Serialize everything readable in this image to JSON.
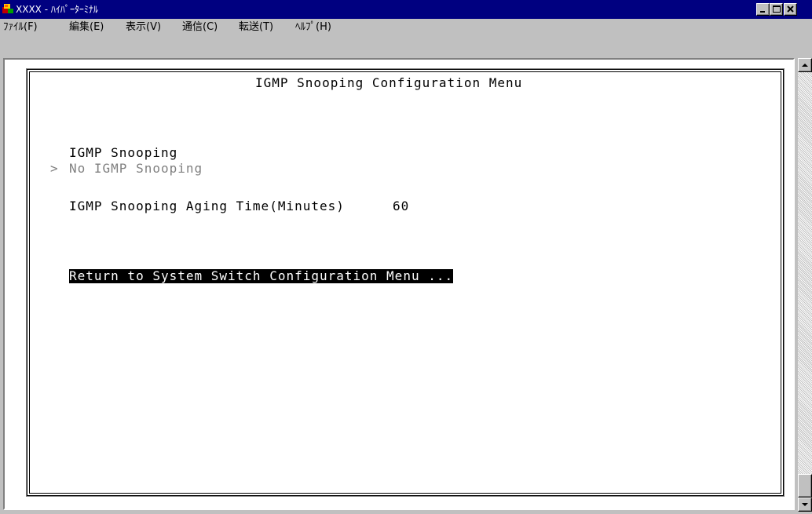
{
  "window": {
    "title": "XXXX - ﾊｲﾊﾟｰﾀｰﾐﾅﾙ",
    "colors": {
      "titlebar": "#000080",
      "face": "#c0c0c0",
      "highlight_bg": "#000000",
      "dim_text": "#808080"
    }
  },
  "menu": {
    "items": [
      {
        "label": "ﾌｧｲﾙ(F)"
      },
      {
        "label": "編集(E)"
      },
      {
        "label": "表示(V)"
      },
      {
        "label": "通信(C)"
      },
      {
        "label": "転送(T)"
      },
      {
        "label": "ﾍﾙﾌﾟ(H)"
      }
    ]
  },
  "terminal": {
    "heading": "IGMP Snooping Configuration Menu",
    "option_group_label": "IGMP Snooping",
    "selection_marker": ">",
    "option_selected": "No IGMP Snooping",
    "aging_label": "IGMP Snooping Aging Time(Minutes)",
    "aging_value": "60",
    "return_link": "Return to System Switch Configuration Menu ..."
  },
  "icons": {
    "app": "hyperterminal-icon",
    "minimize": "minimize-icon",
    "maximize": "maximize-icon",
    "close": "close-icon",
    "scroll_up": "arrow-up-icon",
    "scroll_down": "arrow-down-icon"
  }
}
